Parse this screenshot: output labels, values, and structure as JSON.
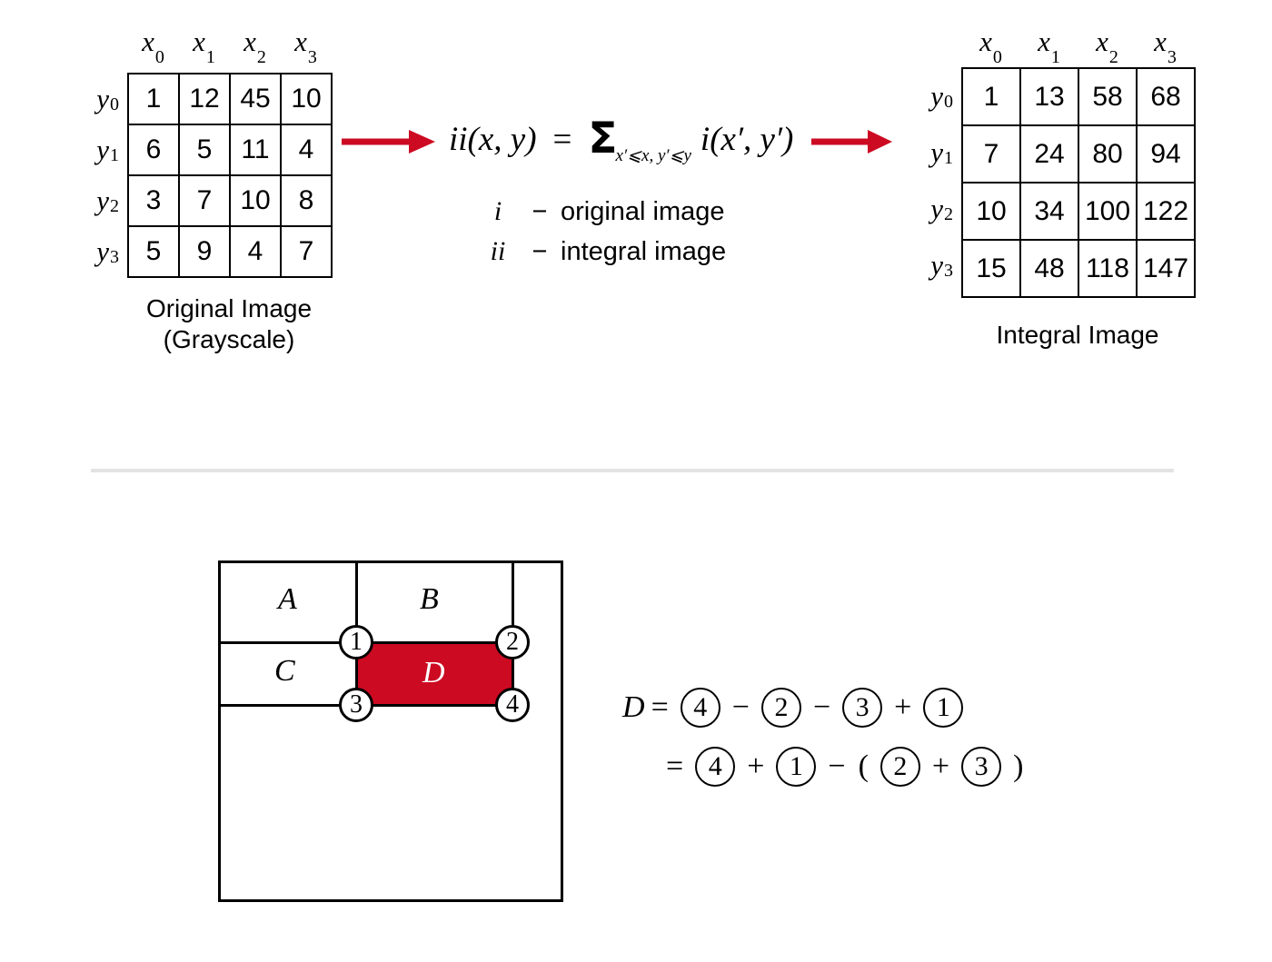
{
  "original_table": {
    "caption_line1": "Original Image",
    "caption_line2": "(Grayscale)",
    "col_headers": [
      "x",
      "x",
      "x",
      "x"
    ],
    "col_subs": [
      "0",
      "1",
      "2",
      "3"
    ],
    "row_headers": [
      "y",
      "y",
      "y",
      "y"
    ],
    "row_subs": [
      "0",
      "1",
      "2",
      "3"
    ],
    "rows": [
      [
        "1",
        "12",
        "45",
        "10"
      ],
      [
        "6",
        "5",
        "11",
        "4"
      ],
      [
        "3",
        "7",
        "10",
        "8"
      ],
      [
        "5",
        "9",
        "4",
        "7"
      ]
    ]
  },
  "integral_table": {
    "caption_line1": "Integral Image",
    "col_headers": [
      "x",
      "x",
      "x",
      "x"
    ],
    "col_subs": [
      "0",
      "1",
      "2",
      "3"
    ],
    "row_headers": [
      "y",
      "y",
      "y",
      "y"
    ],
    "row_subs": [
      "0",
      "1",
      "2",
      "3"
    ],
    "rows": [
      [
        "1",
        "13",
        "58",
        "68"
      ],
      [
        "7",
        "24",
        "80",
        "94"
      ],
      [
        "10",
        "34",
        "100",
        "122"
      ],
      [
        "15",
        "48",
        "118",
        "147"
      ]
    ]
  },
  "formula": {
    "lhs": "ii(x, y)",
    "equals": "=",
    "sigma": "Σ",
    "sigma_subscript": "x′⩽x, y′⩽y",
    "summand": "i(x′, y′)",
    "legend": [
      {
        "symbol": "i",
        "dash": "−",
        "text": "original image"
      },
      {
        "symbol": "ii",
        "dash": "−",
        "text": "integral image"
      }
    ]
  },
  "arrows": {
    "left_arrow": "arrow-right",
    "right_arrow": "arrow-right",
    "color": "#CC0A22"
  },
  "region_diagram": {
    "regions": [
      {
        "id": "A",
        "label": "A"
      },
      {
        "id": "B",
        "label": "B"
      },
      {
        "id": "C",
        "label": "C"
      },
      {
        "id": "D",
        "label": "D"
      }
    ],
    "corners": [
      "1",
      "2",
      "3",
      "4"
    ],
    "highlight_color": "#CC0A22"
  },
  "equation": {
    "line1": {
      "var": "D",
      "equals": "=",
      "tokens": [
        {
          "type": "circle",
          "value": "4"
        },
        {
          "type": "op",
          "value": "−"
        },
        {
          "type": "circle",
          "value": "2"
        },
        {
          "type": "op",
          "value": "−"
        },
        {
          "type": "circle",
          "value": "3"
        },
        {
          "type": "op",
          "value": "+"
        },
        {
          "type": "circle",
          "value": "1"
        }
      ]
    },
    "line2": {
      "equals": "=",
      "tokens": [
        {
          "type": "circle",
          "value": "4"
        },
        {
          "type": "op",
          "value": "+"
        },
        {
          "type": "circle",
          "value": "1"
        },
        {
          "type": "op",
          "value": "−"
        },
        {
          "type": "op",
          "value": "("
        },
        {
          "type": "circle",
          "value": "2"
        },
        {
          "type": "op",
          "value": "+"
        },
        {
          "type": "circle",
          "value": "3"
        },
        {
          "type": "op",
          "value": ")"
        }
      ]
    }
  },
  "divider": {
    "color": "#e3e3e3"
  }
}
